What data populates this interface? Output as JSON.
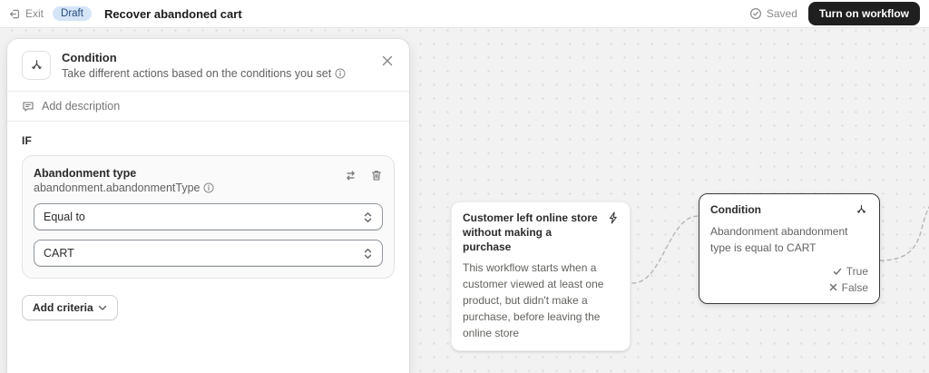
{
  "topbar": {
    "exit_label": "Exit",
    "status_badge": "Draft",
    "title": "Recover abandoned cart",
    "saved_label": "Saved",
    "primary_button_label": "Turn on workflow"
  },
  "panel": {
    "title": "Condition",
    "subtitle": "Take different actions based on the conditions you set",
    "add_description_label": "Add description",
    "if_label": "IF",
    "criteria": {
      "field_label": "Abandonment type",
      "field_path": "abandonment.abandonmentType",
      "operator_selected": "Equal to",
      "value_selected": "CART"
    },
    "add_criteria_label": "Add criteria"
  },
  "canvas": {
    "trigger_node": {
      "title": "Customer left online store without making a purchase",
      "description": "This workflow starts when a customer viewed at least one product, but didn't make a purchase, before leaving the online store"
    },
    "condition_node": {
      "title": "Condition",
      "summary": "Abandonment abandonment type is equal to CART",
      "outputs": [
        {
          "label": "True"
        },
        {
          "label": "False"
        }
      ]
    }
  },
  "colors": {
    "accent_dark": "#1f1f1f",
    "badge_bg": "#d5e5f8",
    "badge_text": "#25497c",
    "canvas_bg": "#f2f2f2",
    "connector": "#b5b5b5"
  }
}
